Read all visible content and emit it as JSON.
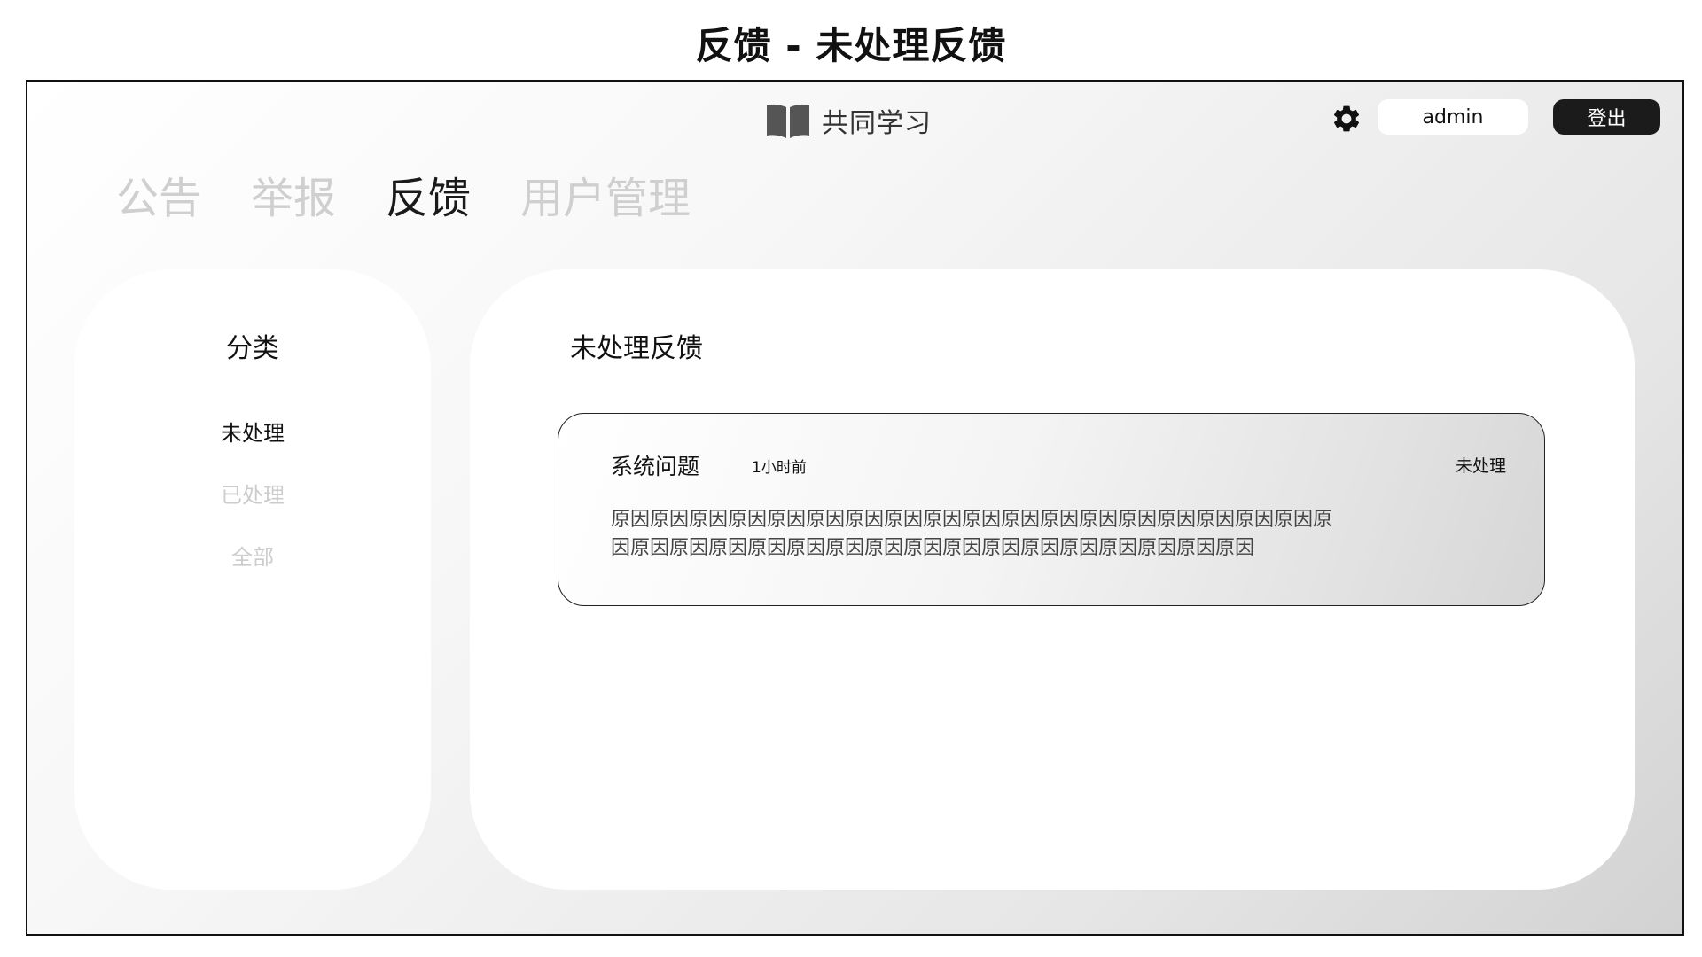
{
  "page": {
    "title": "反馈 - 未处理反馈"
  },
  "header": {
    "brand_text": "共同学习",
    "brand_icon": "open-book-icon",
    "settings_icon": "gear-icon",
    "username": "admin",
    "logout_label": "登出"
  },
  "nav": {
    "tabs": [
      {
        "label": "公告",
        "active": false
      },
      {
        "label": "举报",
        "active": false
      },
      {
        "label": "反馈",
        "active": true
      },
      {
        "label": "用户管理",
        "active": false
      }
    ]
  },
  "sidebar": {
    "heading": "分类",
    "items": [
      {
        "label": "未处理",
        "active": true
      },
      {
        "label": "已处理",
        "active": false
      },
      {
        "label": "全部",
        "active": false
      }
    ]
  },
  "main": {
    "heading": "未处理反馈",
    "feedback": [
      {
        "category": "系统问题",
        "time": "1小时前",
        "status": "未处理",
        "body": "原因原因原因原因原因原因原因原因原因原因原因原因原因原因原因原因原因原因原因原因原因原因原因原因原因原因原因原因原因原因原因原因原因原因原因"
      }
    ]
  },
  "colors": {
    "accent_dark": "#1b1b1b",
    "inactive_text": "#cfcfcf",
    "panel_bg": "#ffffff"
  }
}
